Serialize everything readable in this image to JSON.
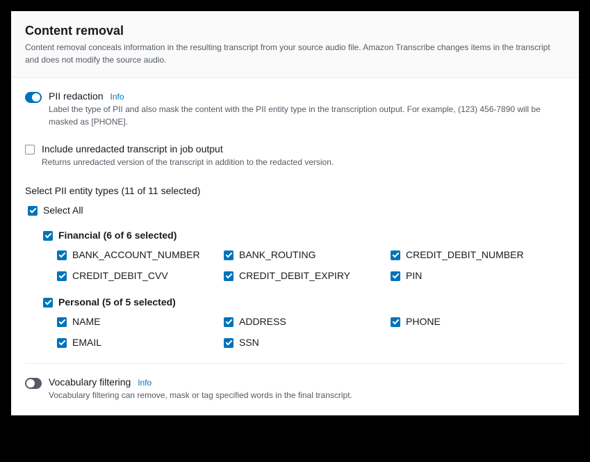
{
  "header": {
    "title": "Content removal",
    "subtitle": "Content removal conceals information in the resulting transcript from your source audio file. Amazon Transcribe changes items in the transcript and does not modify the source audio."
  },
  "pii": {
    "label": "PII redaction",
    "info": "Info",
    "desc": "Label the type of PII and also mask the content with the PII entity type in the transcription output. For example, (123) 456-7890 will be masked as [PHONE].",
    "enabled": true
  },
  "includeUnredacted": {
    "label": "Include unredacted transcript in job output",
    "desc": "Returns unredacted version of the transcript in addition to the redacted version.",
    "checked": false
  },
  "entityHeading": "Select PII entity types (11 of 11 selected)",
  "selectAll": {
    "label": "Select All",
    "checked": true
  },
  "groups": [
    {
      "label": "Financial (6 of 6 selected)",
      "checked": true,
      "items": [
        {
          "label": "BANK_ACCOUNT_NUMBER",
          "checked": true
        },
        {
          "label": "BANK_ROUTING",
          "checked": true
        },
        {
          "label": "CREDIT_DEBIT_NUMBER",
          "checked": true
        },
        {
          "label": "CREDIT_DEBIT_CVV",
          "checked": true
        },
        {
          "label": "CREDIT_DEBIT_EXPIRY",
          "checked": true
        },
        {
          "label": "PIN",
          "checked": true
        }
      ]
    },
    {
      "label": "Personal (5 of 5 selected)",
      "checked": true,
      "items": [
        {
          "label": "NAME",
          "checked": true
        },
        {
          "label": "ADDRESS",
          "checked": true
        },
        {
          "label": "PHONE",
          "checked": true
        },
        {
          "label": "EMAIL",
          "checked": true
        },
        {
          "label": "SSN",
          "checked": true
        }
      ]
    }
  ],
  "vocab": {
    "label": "Vocabulary filtering",
    "info": "Info",
    "desc": "Vocabulary filtering can remove, mask or tag specified words in the final transcript.",
    "enabled": false
  }
}
